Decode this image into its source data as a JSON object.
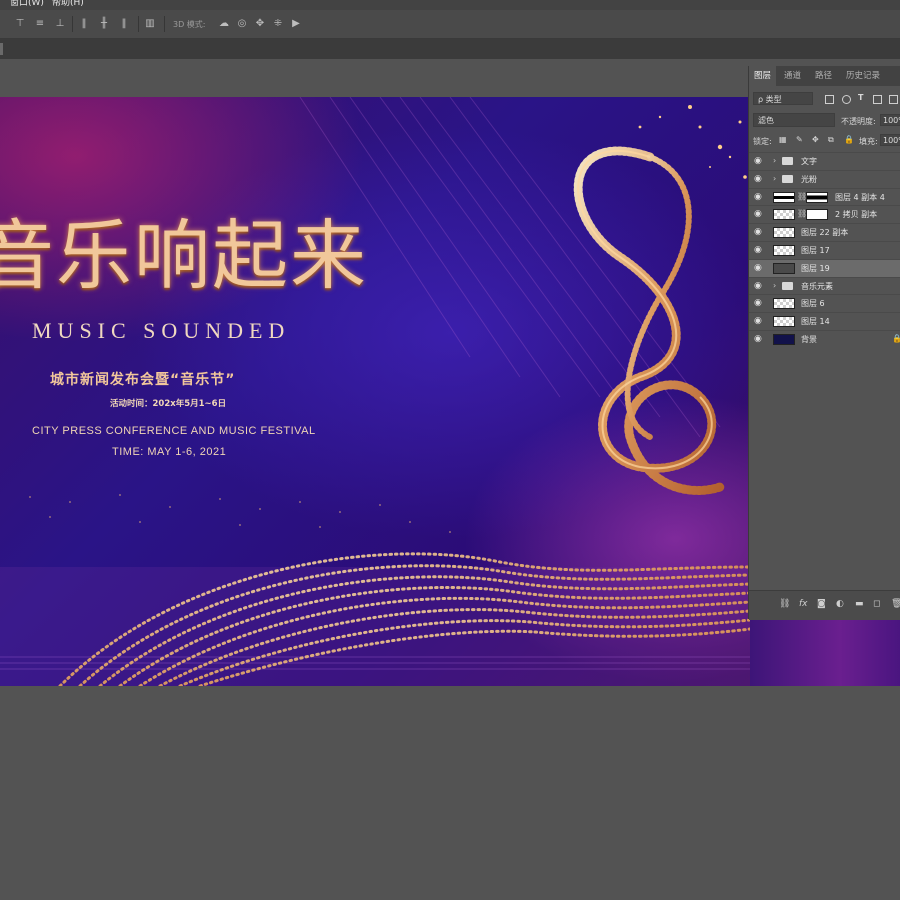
{
  "menubar": {
    "window": "窗口(W)",
    "help": "帮助(H)"
  },
  "options_bar": {
    "mode_3d_label": "3D 模式:"
  },
  "poster": {
    "title_cn": "音乐响起来",
    "title_en": "MUSIC SOUNDED",
    "event_cn": "城市新闻发布会暨“音乐节”",
    "date_cn": "活动时间：202x年5月1~6日",
    "event_en": "CITY PRESS CONFERENCE AND MUSIC FESTIVAL",
    "date_en": "TIME: MAY 1-6, 2021"
  },
  "layers_panel": {
    "tabs": [
      "图层",
      "通道",
      "路径",
      "历史记录"
    ],
    "active_tab": "图层",
    "filter_kind": "ρ 类型",
    "blend_mode": "滤色",
    "opacity_label": "不透明度:",
    "opacity_value": "100%",
    "lock_label": "锁定:",
    "fill_label": "填充:",
    "fill_value": "100%",
    "layers": [
      {
        "name": "文字",
        "type": "group"
      },
      {
        "name": "光粉",
        "type": "group"
      },
      {
        "name": "图层 4 副本 4",
        "type": "masked"
      },
      {
        "name": "2 拷贝 副本",
        "type": "masked"
      },
      {
        "name": "图层 22 副本",
        "type": "layer"
      },
      {
        "name": "图层 17",
        "type": "layer"
      },
      {
        "name": "图层 19",
        "type": "layer",
        "selected": true
      },
      {
        "name": "音乐元素",
        "type": "group"
      },
      {
        "name": "图层 6",
        "type": "layer"
      },
      {
        "name": "图层 14",
        "type": "layer"
      },
      {
        "name": "背景",
        "type": "background"
      }
    ]
  },
  "colors": {
    "gold": "#f1c79a",
    "panel_bg": "#535353",
    "workspace_bg": "#535353"
  }
}
